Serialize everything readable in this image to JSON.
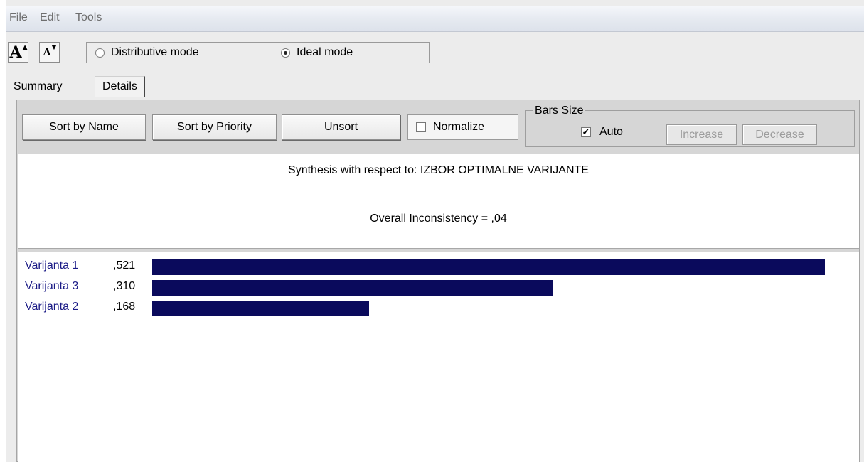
{
  "menu": {
    "items": [
      "File",
      "Edit",
      "Tools"
    ]
  },
  "toolbar": {
    "increase_font_label": "A",
    "decrease_font_label": "A",
    "modes": {
      "distributive": {
        "label": "Distributive mode",
        "selected": false
      },
      "ideal": {
        "label": "Ideal mode",
        "selected": true
      }
    }
  },
  "tabs": [
    {
      "label": "Summary",
      "active": false
    },
    {
      "label": "Details",
      "active": true
    }
  ],
  "controls": {
    "sort_by_name": "Sort by Name",
    "sort_by_priority": "Sort by Priority",
    "unsort": "Unsort",
    "normalize": {
      "label": "Normalize",
      "checked": false
    },
    "bars_size": {
      "legend": "Bars Size",
      "auto": {
        "label": "Auto",
        "checked": true
      },
      "increase": "Increase",
      "decrease": "Decrease"
    }
  },
  "synthesis": {
    "title": "Synthesis with respect to: IZBOR OPTIMALNE VARIJANTE",
    "inconsistency": "Overall Inconsistency = ,04"
  },
  "results": [
    {
      "name": "Varijanta 1",
      "value_label": ",521",
      "value": 0.521
    },
    {
      "name": "Varijanta 3",
      "value_label": ",310",
      "value": 0.31
    },
    {
      "name": "Varijanta 2",
      "value_label": ",168",
      "value": 0.168
    }
  ],
  "colors": {
    "bar": "#0a0a5c",
    "alternative_name": "#1a1a86"
  }
}
